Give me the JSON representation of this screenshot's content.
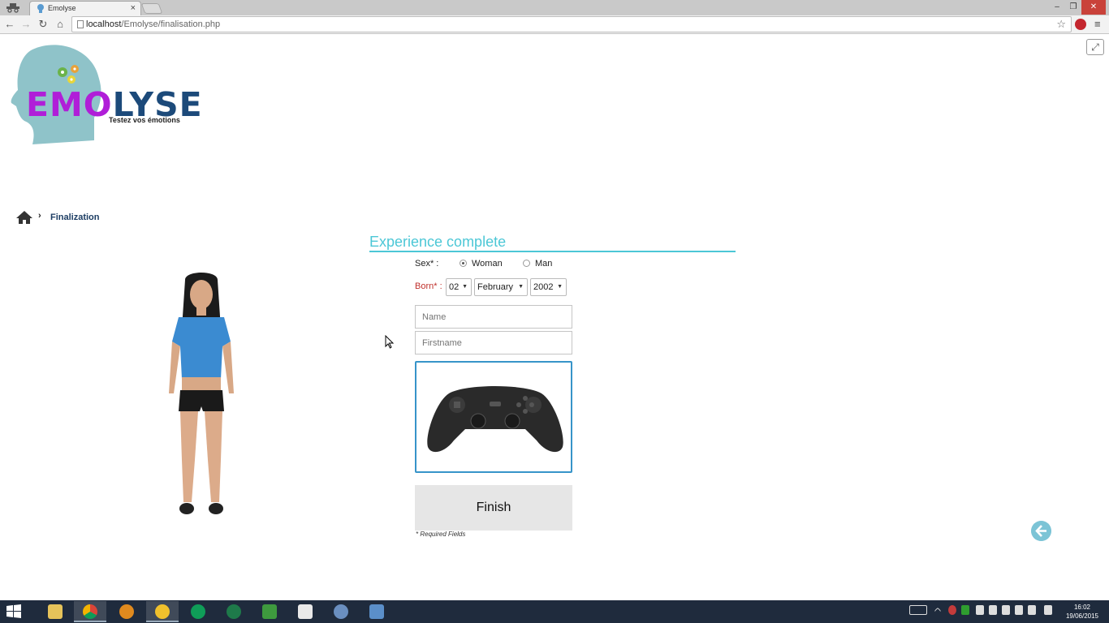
{
  "browser": {
    "tab_title": "Emolyse",
    "tab_close": "×",
    "url_host": "localhost",
    "url_path": "/Emolyse/finalisation.php",
    "controls": {
      "minimize": "–",
      "maximize": "❐",
      "close": "✕"
    },
    "nav": {
      "back": "←",
      "forward": "→",
      "reload": "↻",
      "home": "⌂"
    },
    "star": "☆",
    "menu": "≡"
  },
  "page": {
    "fullscreen_icon": "⤢",
    "logo": {
      "emo": "EMO",
      "lyse": "LYSE",
      "tagline": "Testez vos émotions"
    },
    "breadcrumb": {
      "separator": "›",
      "current": "Finalization"
    },
    "form": {
      "title": "Experience complete",
      "sex_label": "Sex* :",
      "sex_options": [
        {
          "label": "Woman",
          "selected": true
        },
        {
          "label": "Man",
          "selected": false
        }
      ],
      "born_label": "Born* :",
      "day": "02",
      "month": "February",
      "year": "2002",
      "name_placeholder": "Name",
      "firstname_placeholder": "Firstname",
      "finish_label": "Finish",
      "required_note": "* Required Fields"
    }
  },
  "taskbar": {
    "time": "16:02",
    "date": "19/06/2015"
  },
  "colors": {
    "accent": "#4cc7d6",
    "logo_purple": "#b01ed8",
    "logo_blue": "#1c4a7a",
    "required_red": "#c0312c",
    "selection_border": "#3794c9"
  }
}
